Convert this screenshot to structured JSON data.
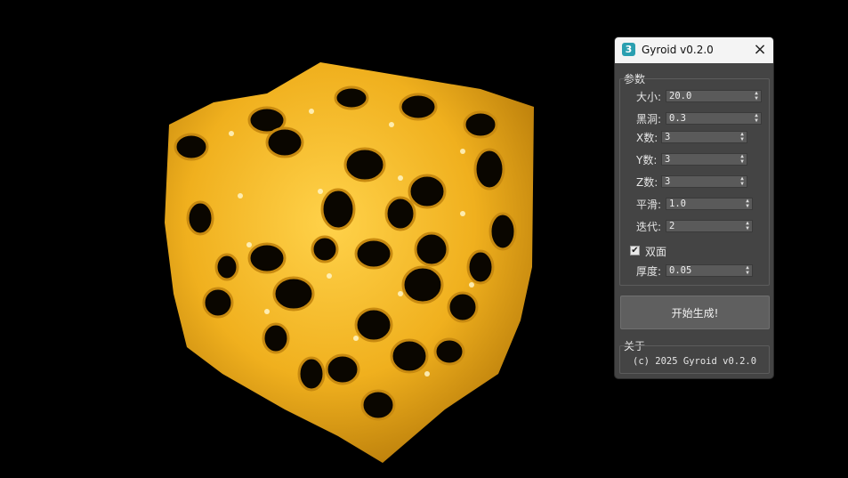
{
  "dialog": {
    "title": "Gyroid v0.2.0",
    "icon_glyph": "3",
    "close_icon": "×",
    "params_group_label": "参数",
    "params": [
      {
        "label": "大小:",
        "value": "20.0"
      },
      {
        "label": "黑洞:",
        "value": "0.3"
      },
      {
        "label": "X数:",
        "value": "3"
      },
      {
        "label": "Y数:",
        "value": "3"
      },
      {
        "label": "Z数:",
        "value": "3"
      },
      {
        "label": "平滑:",
        "value": "1.0"
      },
      {
        "label": "迭代:",
        "value": "2"
      }
    ],
    "double_sided": {
      "label": "双面",
      "checked": true,
      "check_glyph": "✔"
    },
    "thickness": {
      "label": "厚度:",
      "value": "0.05"
    },
    "generate_button": "开始生成!",
    "about_group_label": "关于",
    "about_text": "(c) 2025 Gyroid v0.2.0"
  },
  "viewport": {
    "object": "yellow gyroid lattice cube",
    "object_color": "#f2b31c",
    "background": "#000000"
  }
}
